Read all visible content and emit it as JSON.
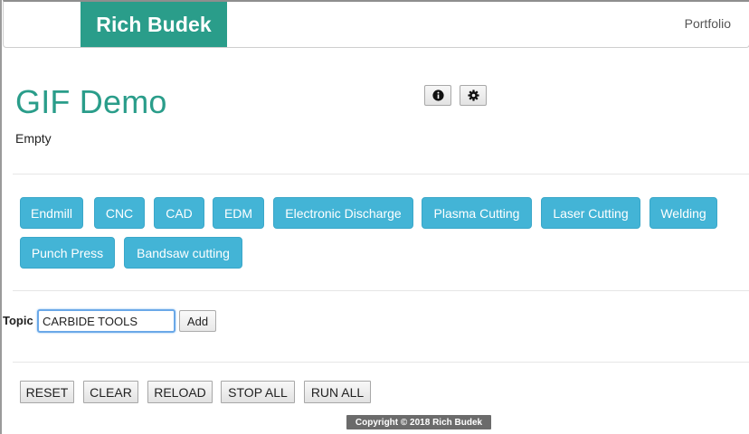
{
  "navbar": {
    "brand": "Rich Budek",
    "links": [
      "Portfolio"
    ]
  },
  "header": {
    "title": "GIF Demo",
    "status": "Empty",
    "icons": [
      "info-icon",
      "gear-icon"
    ]
  },
  "tags": [
    "Endmill",
    "CNC",
    "CAD",
    "EDM",
    "Electronic Discharge",
    "Plasma Cutting",
    "Laser Cutting",
    "Welding",
    "Punch Press",
    "Bandsaw cutting"
  ],
  "topic_form": {
    "label": "Topic",
    "value": "CARBIDE TOOLS",
    "add_label": "Add"
  },
  "actions": [
    "RESET",
    "CLEAR",
    "RELOAD",
    "STOP ALL",
    "RUN ALL"
  ],
  "footer": "Copyright © 2018 Rich Budek",
  "colors": {
    "brand": "#2a9d8a",
    "tag": "#43b4d6",
    "footer": "#6b6b6b"
  }
}
